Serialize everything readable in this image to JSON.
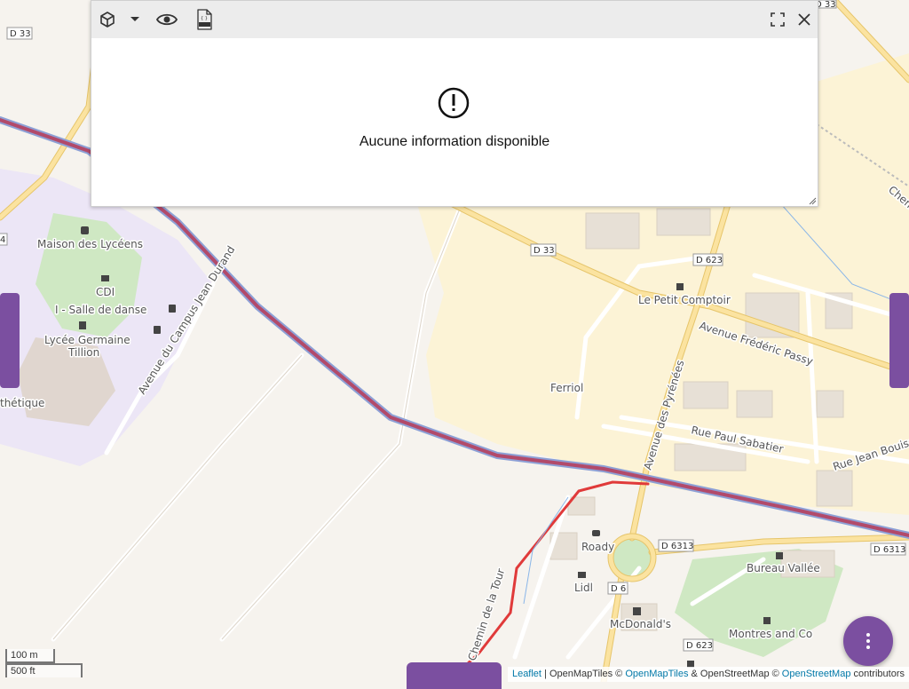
{
  "map": {
    "places": {
      "maison_lyceens": "Maison des Lycéens",
      "cdi": "CDI",
      "salle_danse": "I - Salle de danse",
      "lycee_line1": "Lycée Germaine",
      "lycee_line2": "Tillion",
      "thetique": "thétique",
      "ferriol": "Ferriol",
      "petit_comptoir": "Le Petit Comptoir",
      "roady": "Roady",
      "lidl": "Lidl",
      "mcdonalds": "McDonald's",
      "bureau_vallee": "Bureau Vallée",
      "montres": "Montres and Co",
      "chem_partial": "Chem"
    },
    "streets": {
      "campus": "Avenue du Campus Jean Durand",
      "frederic_passy": "Avenue Frédéric Passy",
      "pyrenees": "Avenue des Pyrénées",
      "paul_sabatier": "Rue Paul Sabatier",
      "jean_bouisson": "Rue Jean Bouisson",
      "chemin_tour": "Chemin de la Tour"
    },
    "shields": {
      "d33_a": "D 33",
      "d33_b": "D 33",
      "d33_c": "D 33",
      "d623_a": "D 623",
      "d623_b": "D 623",
      "d6313_a": "D 6313",
      "d6313_b": "D 6313",
      "d6": "D 6",
      "edge_4": "4"
    },
    "colors": {
      "land": "#f6f3ee",
      "commercial": "#fcf3d6",
      "school": "#ece6f6",
      "park": "#cfe8c3",
      "road": "#ffffff",
      "major_road": "#fbe3a0",
      "railway_outline": "#8da0d6",
      "railway_fill": "#b24a6a",
      "route": "#e03a3a"
    }
  },
  "panel": {
    "message": "Aucune information disponible",
    "icons": [
      "cube-icon",
      "dropdown-caret-icon",
      "eye-icon",
      "json-file-icon",
      "fullscreen-icon",
      "close-icon"
    ],
    "json_badge": "{ }"
  },
  "scale": {
    "metric": "100 m",
    "imperial": "500 ft"
  },
  "attribution": {
    "leaflet": "Leaflet",
    "sep1": " | ",
    "openmaptiles_text": "OpenMapTiles ©",
    "openmaptiles_link": "OpenMapTiles",
    "amp": " & ",
    "osm_text": "OpenStreetMap ©",
    "osm_link": "OpenStreetMap",
    "contributors": "contributors"
  },
  "ui_colors": {
    "accent": "#7b4fa0",
    "panel_toolbar": "#ececec"
  }
}
